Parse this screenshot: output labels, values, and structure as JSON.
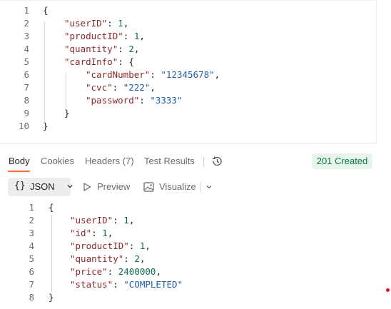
{
  "request_body": {
    "lines": [
      {
        "n": "1",
        "indent": 0,
        "parts": [
          [
            "p",
            "{"
          ]
        ]
      },
      {
        "n": "2",
        "indent": 1,
        "parts": [
          [
            "k",
            "\"userID\""
          ],
          [
            "p",
            ": "
          ],
          [
            "n",
            "1"
          ],
          [
            "p",
            ","
          ]
        ]
      },
      {
        "n": "3",
        "indent": 1,
        "parts": [
          [
            "k",
            "\"productID\""
          ],
          [
            "p",
            ": "
          ],
          [
            "n",
            "1"
          ],
          [
            "p",
            ","
          ]
        ]
      },
      {
        "n": "4",
        "indent": 1,
        "parts": [
          [
            "k",
            "\"quantity\""
          ],
          [
            "p",
            ": "
          ],
          [
            "n",
            "2"
          ],
          [
            "p",
            ","
          ]
        ]
      },
      {
        "n": "5",
        "indent": 1,
        "parts": [
          [
            "k",
            "\"cardInfo\""
          ],
          [
            "p",
            ": {"
          ]
        ]
      },
      {
        "n": "6",
        "indent": 2,
        "parts": [
          [
            "k",
            "\"cardNumber\""
          ],
          [
            "p",
            ": "
          ],
          [
            "s",
            "\"12345678\""
          ],
          [
            "p",
            ","
          ]
        ]
      },
      {
        "n": "7",
        "indent": 2,
        "parts": [
          [
            "k",
            "\"cvc\""
          ],
          [
            "p",
            ": "
          ],
          [
            "s",
            "\"222\""
          ],
          [
            "p",
            ","
          ]
        ]
      },
      {
        "n": "8",
        "indent": 2,
        "parts": [
          [
            "k",
            "\"password\""
          ],
          [
            "p",
            ": "
          ],
          [
            "s",
            "\"3333\""
          ]
        ]
      },
      {
        "n": "9",
        "indent": 1,
        "parts": [
          [
            "p",
            "}"
          ]
        ]
      },
      {
        "n": "10",
        "indent": 0,
        "parts": [
          [
            "p",
            "}"
          ]
        ]
      }
    ]
  },
  "response_tabs": [
    {
      "label": "Body",
      "active": true
    },
    {
      "label": "Cookies",
      "active": false
    },
    {
      "label": "Headers (7)",
      "active": false
    },
    {
      "label": "Test Results",
      "active": false
    }
  ],
  "history_icon": "history-icon",
  "status": {
    "label": "201 Created",
    "color": "#0a7a3e",
    "background": "#e7f5ed"
  },
  "toolbar": {
    "format_icon": "{}",
    "format_label": "JSON",
    "preview_label": "Preview",
    "visualize_label": "Visualize"
  },
  "response_body": {
    "lines": [
      {
        "n": "1",
        "indent": 0,
        "parts": [
          [
            "p",
            "{"
          ]
        ]
      },
      {
        "n": "2",
        "indent": 1,
        "parts": [
          [
            "k",
            "\"userID\""
          ],
          [
            "p",
            ": "
          ],
          [
            "n",
            "1"
          ],
          [
            "p",
            ","
          ]
        ]
      },
      {
        "n": "3",
        "indent": 1,
        "parts": [
          [
            "k",
            "\"id\""
          ],
          [
            "p",
            ": "
          ],
          [
            "n",
            "1"
          ],
          [
            "p",
            ","
          ]
        ]
      },
      {
        "n": "4",
        "indent": 1,
        "parts": [
          [
            "k",
            "\"productID\""
          ],
          [
            "p",
            ": "
          ],
          [
            "n",
            "1"
          ],
          [
            "p",
            ","
          ]
        ]
      },
      {
        "n": "5",
        "indent": 1,
        "parts": [
          [
            "k",
            "\"quantity\""
          ],
          [
            "p",
            ": "
          ],
          [
            "n",
            "2"
          ],
          [
            "p",
            ","
          ]
        ]
      },
      {
        "n": "6",
        "indent": 1,
        "parts": [
          [
            "k",
            "\"price\""
          ],
          [
            "p",
            ": "
          ],
          [
            "n",
            "2400000"
          ],
          [
            "p",
            ","
          ]
        ]
      },
      {
        "n": "7",
        "indent": 1,
        "parts": [
          [
            "k",
            "\"status\""
          ],
          [
            "p",
            ": "
          ],
          [
            "s",
            "\"COMPLETED\""
          ]
        ]
      },
      {
        "n": "8",
        "indent": 0,
        "parts": [
          [
            "p",
            "}"
          ]
        ]
      }
    ]
  },
  "colors": {
    "accent": "#ff6c37",
    "key": "#8c2a2a",
    "number": "#0b6e4f",
    "string": "#1d5ea8"
  }
}
